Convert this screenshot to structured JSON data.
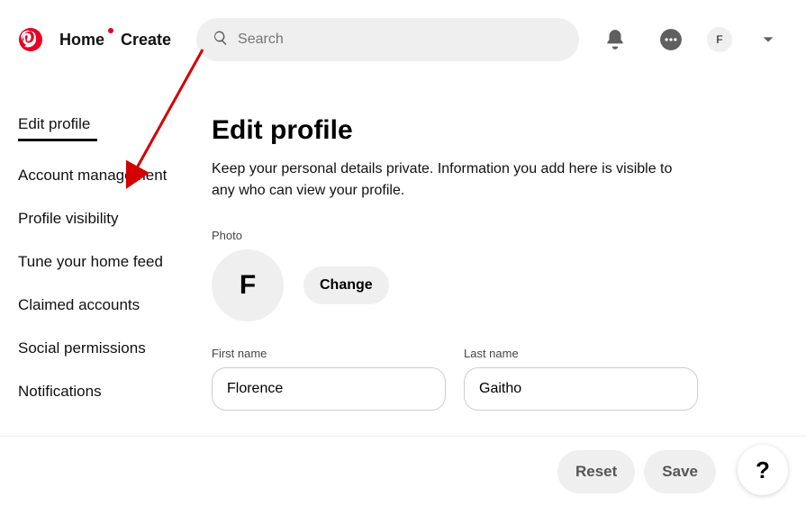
{
  "header": {
    "home": "Home",
    "create": "Create",
    "search_placeholder": "Search",
    "avatar_letter": "F"
  },
  "sidebar": {
    "items": [
      "Edit profile",
      "Account management",
      "Profile visibility",
      "Tune your home feed",
      "Claimed accounts",
      "Social permissions",
      "Notifications"
    ]
  },
  "main": {
    "title": "Edit profile",
    "subtitle": "Keep your personal details private. Information you add here is visible to any who can view your profile.",
    "photo_label": "Photo",
    "avatar_letter": "F",
    "change_label": "Change",
    "first_name_label": "First name",
    "first_name_value": "Florence",
    "last_name_label": "Last name",
    "last_name_value": "Gaitho"
  },
  "footer": {
    "reset": "Reset",
    "save": "Save",
    "help": "?"
  },
  "colors": {
    "brand_red": "#e60023"
  }
}
